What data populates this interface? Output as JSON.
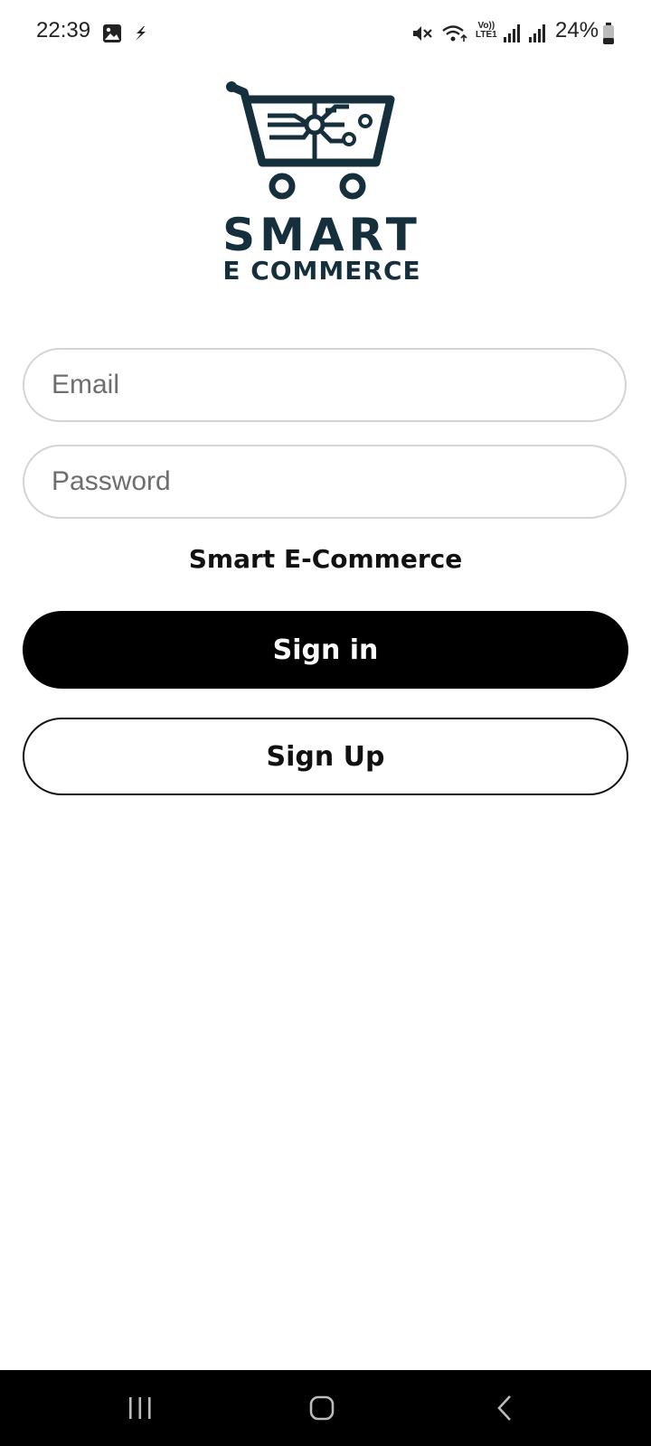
{
  "status_bar": {
    "time": "22:39",
    "battery_percent": "24%",
    "network_label_top": "Vo))",
    "network_label_bottom": "LTE1",
    "icons": [
      "image-icon",
      "flash-icon",
      "mute-icon",
      "wifi-icon",
      "signal-icon",
      "signal-icon",
      "battery-icon"
    ]
  },
  "logo": {
    "line1": "SMART",
    "line2": "E COMMERCE",
    "icon": "cart-icon",
    "color": "#15303c"
  },
  "form": {
    "email_placeholder": "Email",
    "email_value": "",
    "password_placeholder": "Password",
    "password_value": ""
  },
  "brand_caption": "Smart E-Commerce",
  "buttons": {
    "sign_in": "Sign in",
    "sign_up": "Sign Up"
  },
  "nav_bar": {
    "icons": [
      "recent-apps-icon",
      "home-icon",
      "back-icon"
    ]
  },
  "colors": {
    "primary_button": "#000000",
    "input_border": "#d4d4d4",
    "logo": "#15303c"
  }
}
